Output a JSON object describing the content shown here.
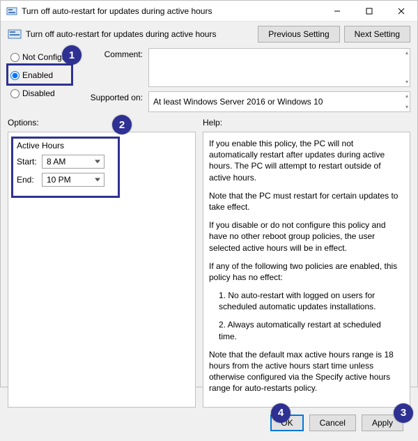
{
  "window": {
    "title": "Turn off auto-restart for updates during active hours"
  },
  "header": {
    "title": "Turn off auto-restart for updates during active hours",
    "prev": "Previous Setting",
    "next": "Next Setting"
  },
  "config": {
    "not_configured": "Not Configured",
    "enabled": "Enabled",
    "disabled": "Disabled",
    "comment_label": "Comment:",
    "supported_label": "Supported on:",
    "supported_text": "At least Windows Server 2016 or Windows 10"
  },
  "options": {
    "header": "Options:",
    "active_hours": "Active Hours",
    "start_label": "Start:",
    "end_label": "End:",
    "start_value": "8 AM",
    "end_value": "10 PM"
  },
  "help": {
    "header": "Help:",
    "p1": "If you enable this policy, the PC will not automatically restart after updates during active hours. The PC will attempt to restart outside of active hours.",
    "p2": "Note that the PC must restart for certain updates to take effect.",
    "p3": "If you disable or do not configure this policy and have no other reboot group policies, the user selected active hours will be in effect.",
    "p4": "If any of the following two policies are enabled, this policy has no effect:",
    "p4a": "1. No auto-restart with logged on users for scheduled automatic updates installations.",
    "p4b": "2. Always automatically restart at scheduled time.",
    "p5": "Note that the default max active hours range is 18 hours from the active hours start time unless otherwise configured via the Specify active hours range for auto-restarts policy."
  },
  "footer": {
    "ok": "OK",
    "cancel": "Cancel",
    "apply": "Apply"
  },
  "callouts": {
    "c1": "1",
    "c2": "2",
    "c3": "3",
    "c4": "4"
  }
}
